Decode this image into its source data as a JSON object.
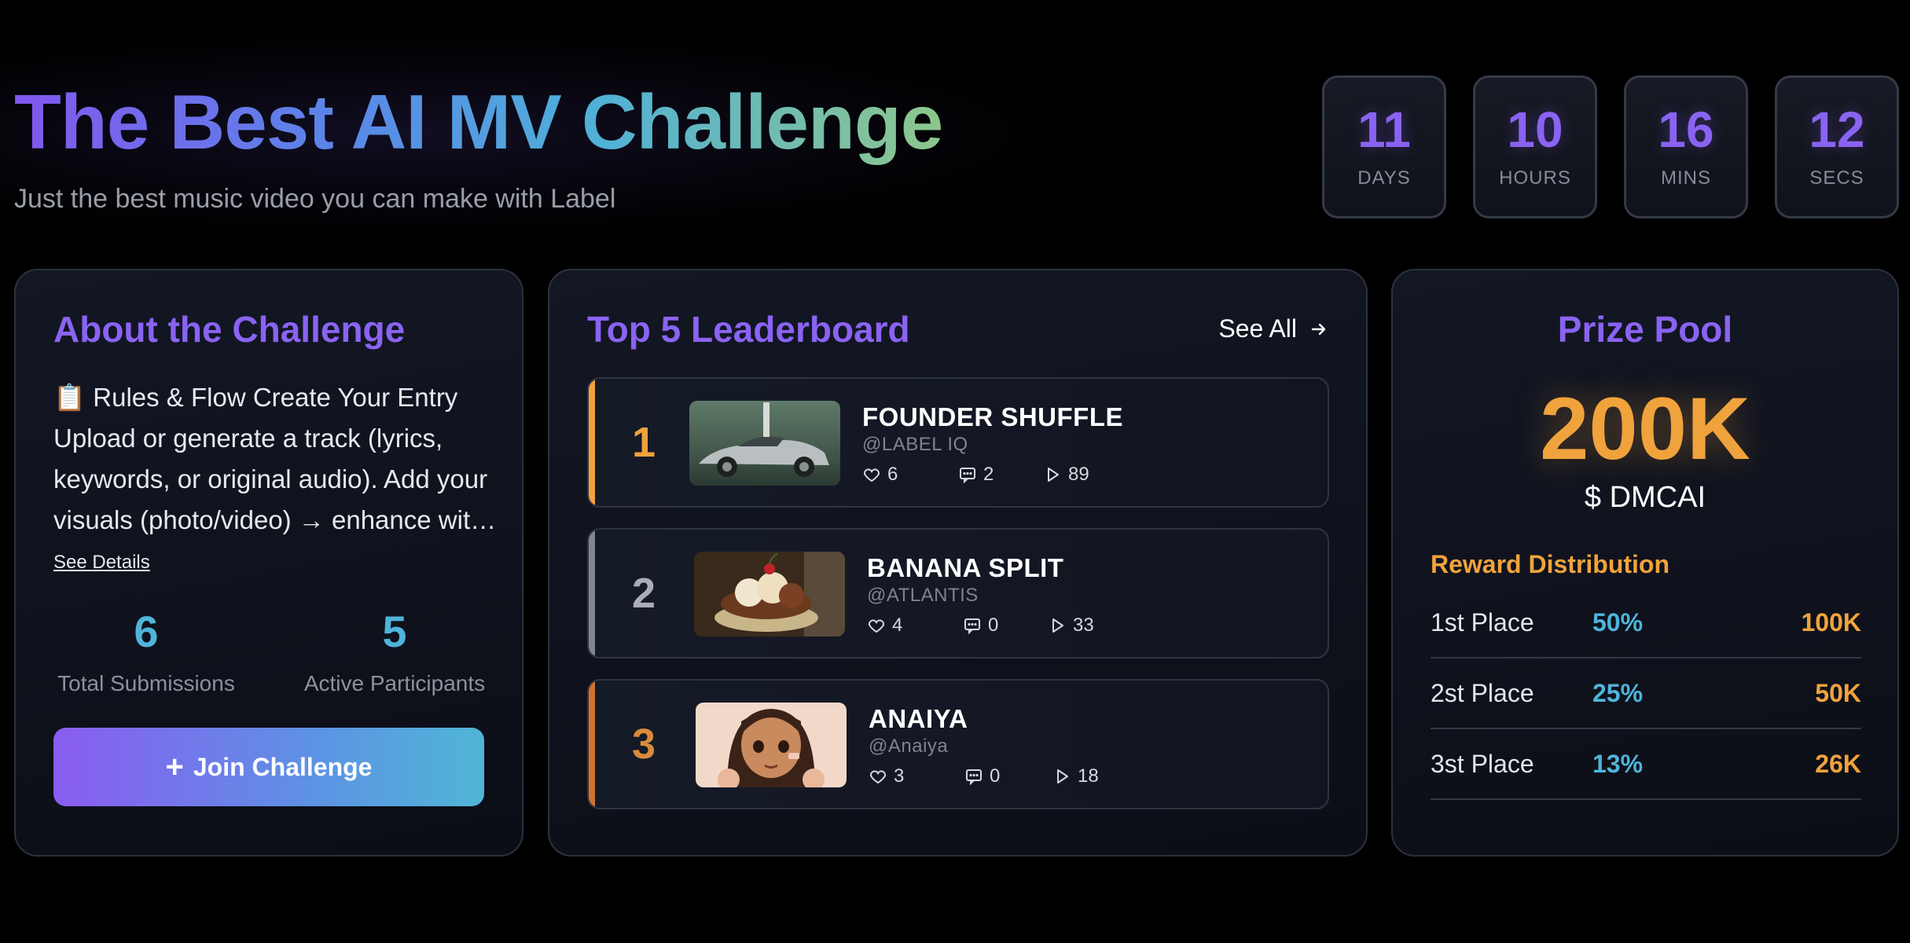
{
  "header": {
    "title": "The Best AI MV Challenge",
    "subtitle": "Just the best music video you can make with Label"
  },
  "countdown": [
    {
      "value": "11",
      "unit": "DAYS"
    },
    {
      "value": "10",
      "unit": "HOURS"
    },
    {
      "value": "16",
      "unit": "MINS"
    },
    {
      "value": "12",
      "unit": "SECS"
    }
  ],
  "about": {
    "title": "About the Challenge",
    "description": "📋 Rules & Flow Create Your Entry Upload or generate a track (lyrics, keywords, or original audio). Add your visuals (photo/video) → enhance with AI tools and publish your music video to the challenge.",
    "see_details": "See Details",
    "stats": [
      {
        "value": "6",
        "label": "Total Submissions"
      },
      {
        "value": "5",
        "label": "Active Participants"
      }
    ],
    "join_icon": "+",
    "join_label": "Join Challenge"
  },
  "leaderboard": {
    "title": "Top 5 Leaderboard",
    "see_all": "See All",
    "see_all_icon": "arrow-right-icon",
    "entries": [
      {
        "rank": "1",
        "title": "FOUNDER SHUFFLE",
        "handle": "@LABEL IQ",
        "likes": "6",
        "comments": "2",
        "plays": "89",
        "accent": "#f0a33c",
        "rank_color": "#f0a33c"
      },
      {
        "rank": "2",
        "title": "BANANA SPLIT",
        "handle": "@ATLANTIS",
        "likes": "4",
        "comments": "0",
        "plays": "33",
        "accent": "#7d8597",
        "rank_color": "#a9adb8"
      },
      {
        "rank": "3",
        "title": "ANAIYA",
        "handle": "@Anaiya",
        "likes": "3",
        "comments": "0",
        "plays": "18",
        "accent": "#d0722c",
        "rank_color": "#d98a3c"
      }
    ]
  },
  "prize": {
    "title": "Prize Pool",
    "amount": "200K",
    "currency": "$ DMCAI",
    "distribution_title": "Reward Distribution",
    "rows": [
      {
        "place": "1st Place",
        "percent": "50%",
        "amount": "100K"
      },
      {
        "place": "2st Place",
        "percent": "25%",
        "amount": "50K"
      },
      {
        "place": "3st Place",
        "percent": "13%",
        "amount": "26K"
      }
    ]
  },
  "colors": {
    "accent_purple": "#8a63f2",
    "accent_cyan": "#4fb4da",
    "accent_orange": "#f0a33c",
    "background": "#000000",
    "card_border": "#2c3140"
  }
}
